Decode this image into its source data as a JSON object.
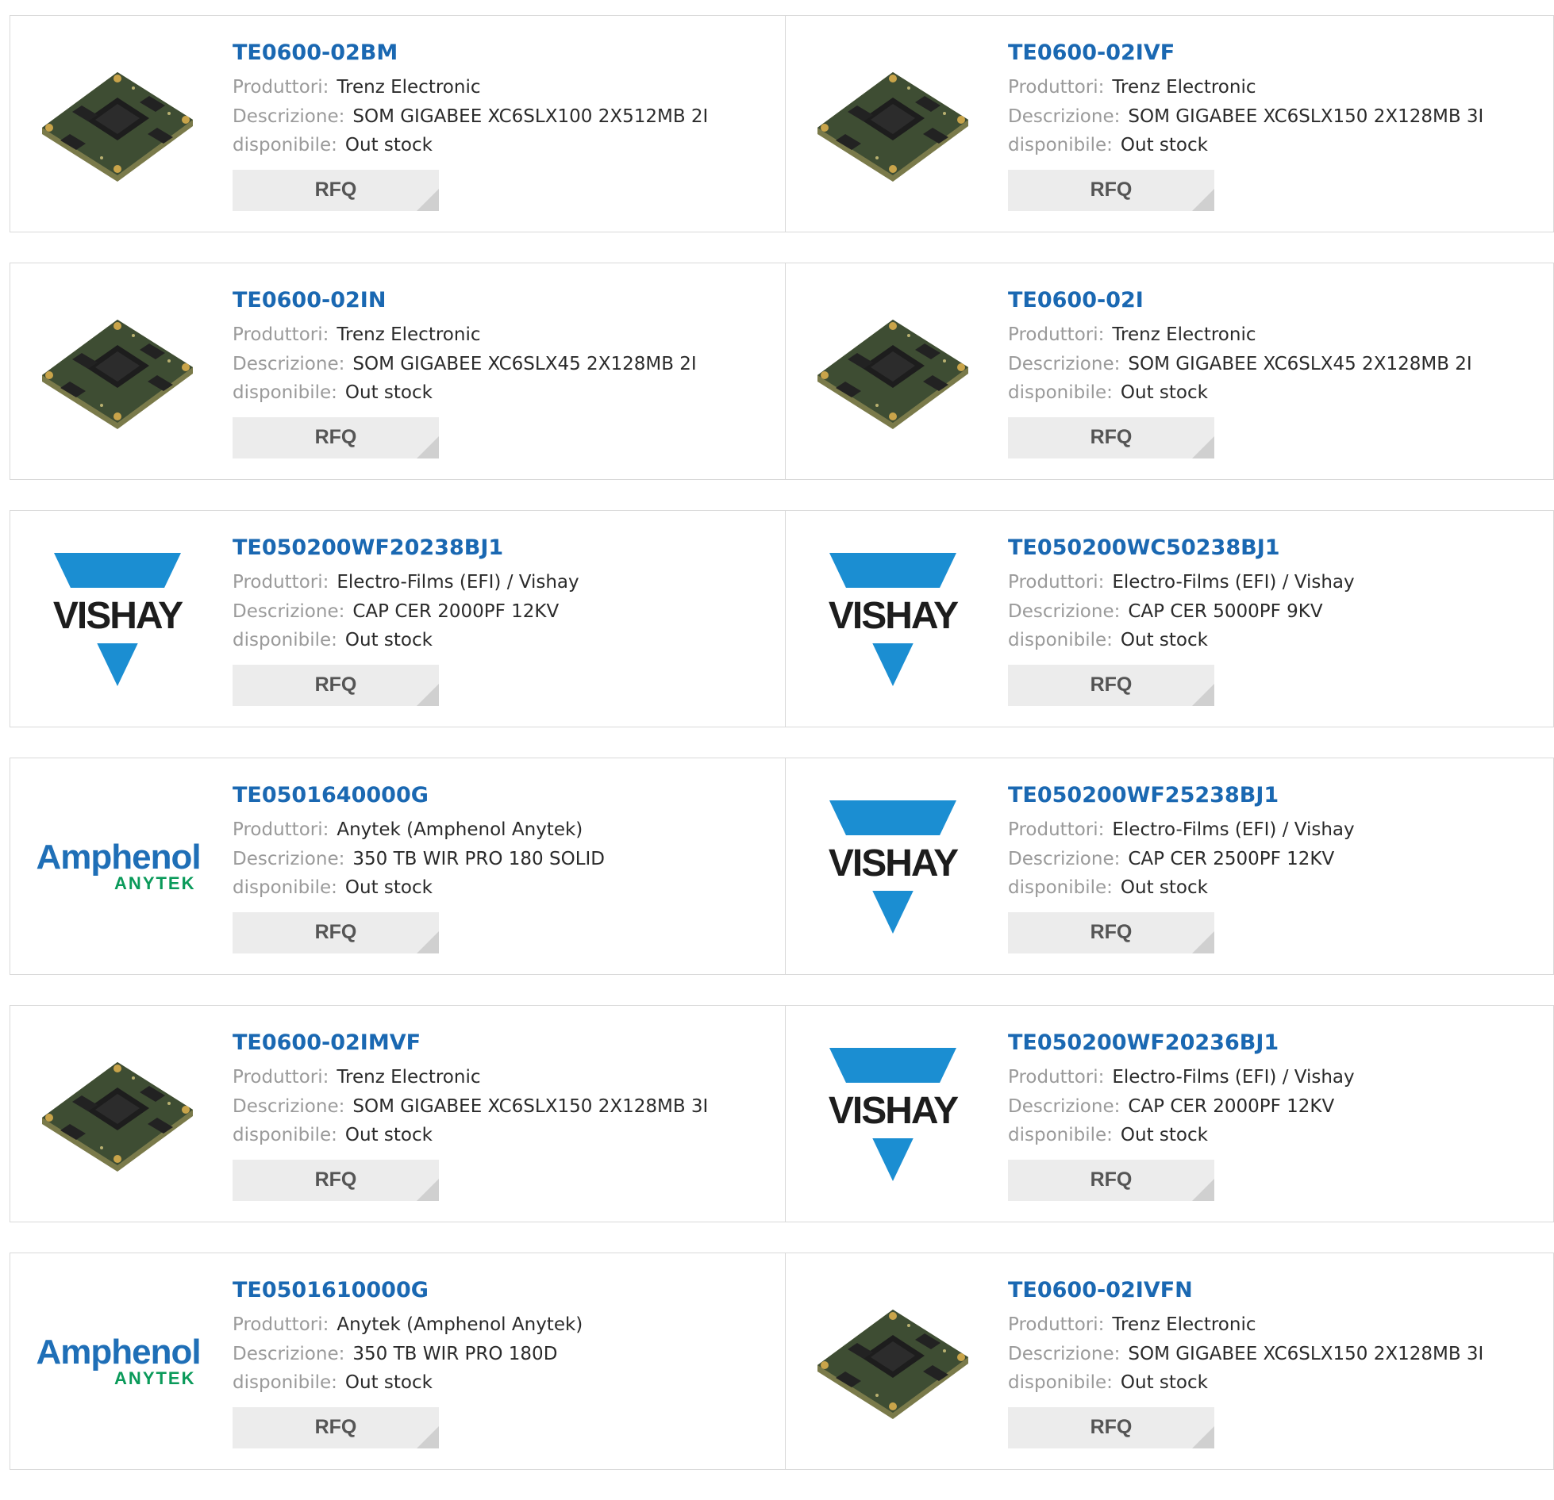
{
  "labels": {
    "manufacturer": "Produttori:",
    "description": "Descrizione:",
    "availability": "disponibile:",
    "rfq": "RFQ"
  },
  "logos": {
    "vishay": "VISHAY",
    "amphenol_top": "Amphenol",
    "amphenol_bottom": "ANYTEK"
  },
  "colors": {
    "part_link": "#1a68b2",
    "vishay_blue": "#1b8ed2",
    "amphenol_blue": "#1f6fb7",
    "amphenol_green": "#0a9a5a"
  },
  "products": [
    {
      "part": "TE0600-02BM",
      "manufacturer": "Trenz Electronic",
      "description": "SOM GIGABEE XC6SLX100 2X512MB 2I",
      "availability": "Out stock",
      "image": "board"
    },
    {
      "part": "TE0600-02IVF",
      "manufacturer": "Trenz Electronic",
      "description": "SOM GIGABEE XC6SLX150 2X128MB 3I",
      "availability": "Out stock",
      "image": "board"
    },
    {
      "part": "TE0600-02IN",
      "manufacturer": "Trenz Electronic",
      "description": "SOM GIGABEE XC6SLX45 2X128MB 2I",
      "availability": "Out stock",
      "image": "board"
    },
    {
      "part": "TE0600-02I",
      "manufacturer": "Trenz Electronic",
      "description": "SOM GIGABEE XC6SLX45 2X128MB 2I",
      "availability": "Out stock",
      "image": "board"
    },
    {
      "part": "TE050200WF20238BJ1",
      "manufacturer": "Electro-Films (EFI) / Vishay",
      "description": "CAP CER 2000PF 12KV",
      "availability": "Out stock",
      "image": "vishay"
    },
    {
      "part": "TE050200WC50238BJ1",
      "manufacturer": "Electro-Films (EFI) / Vishay",
      "description": "CAP CER 5000PF 9KV",
      "availability": "Out stock",
      "image": "vishay"
    },
    {
      "part": "TE0501640000G",
      "manufacturer": "Anytek (Amphenol Anytek)",
      "description": "350 TB WIR PRO 180 SOLID",
      "availability": "Out stock",
      "image": "amphenol"
    },
    {
      "part": "TE050200WF25238BJ1",
      "manufacturer": "Electro-Films (EFI) / Vishay",
      "description": "CAP CER 2500PF 12KV",
      "availability": "Out stock",
      "image": "vishay"
    },
    {
      "part": "TE0600-02IMVF",
      "manufacturer": "Trenz Electronic",
      "description": "SOM GIGABEE XC6SLX150 2X128MB 3I",
      "availability": "Out stock",
      "image": "board"
    },
    {
      "part": "TE050200WF20236BJ1",
      "manufacturer": "Electro-Films (EFI) / Vishay",
      "description": "CAP CER 2000PF 12KV",
      "availability": "Out stock",
      "image": "vishay"
    },
    {
      "part": "TE0501610000G",
      "manufacturer": "Anytek (Amphenol Anytek)",
      "description": "350 TB WIR PRO 180D",
      "availability": "Out stock",
      "image": "amphenol"
    },
    {
      "part": "TE0600-02IVFN",
      "manufacturer": "Trenz Electronic",
      "description": "SOM GIGABEE XC6SLX150 2X128MB 3I",
      "availability": "Out stock",
      "image": "board"
    }
  ]
}
